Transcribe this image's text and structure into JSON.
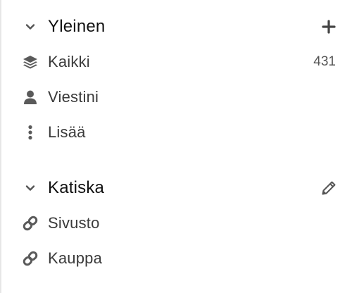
{
  "sections": [
    {
      "title": "Yleinen",
      "toggle_icon": "chevron-down-icon",
      "action_icon": "plus-icon",
      "items": [
        {
          "label": "Kaikki",
          "icon": "layers-icon",
          "count": "431"
        },
        {
          "label": "Viestini",
          "icon": "user-icon"
        },
        {
          "label": "Lisää",
          "icon": "more-vertical-icon"
        }
      ]
    },
    {
      "title": "Katiska",
      "toggle_icon": "chevron-down-icon",
      "action_icon": "pencil-icon",
      "items": [
        {
          "label": "Sivusto",
          "icon": "link-icon"
        },
        {
          "label": "Kauppa",
          "icon": "link-icon"
        }
      ]
    }
  ],
  "colors": {
    "icon": "#5a5a5a",
    "text": "#3a3a3a",
    "heading": "#111111",
    "divider": "#e6e6e6"
  }
}
